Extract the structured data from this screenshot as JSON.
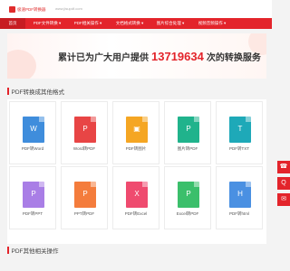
{
  "header": {
    "logo_text": "极速PDF转换器",
    "site_url": "www.jisupdf.com"
  },
  "nav": {
    "items": [
      {
        "label": "首页",
        "active": true
      },
      {
        "label": "PDF文件转换 ▾",
        "active": false
      },
      {
        "label": "PDF相关操作 ▾",
        "active": false
      },
      {
        "label": "文档格式转换 ▾",
        "active": false
      },
      {
        "label": "图片综合处理 ▾",
        "active": false
      },
      {
        "label": "视频音频操作 ▾",
        "active": false
      }
    ]
  },
  "banner": {
    "prefix": "累计已为广大用户提供",
    "count": "13719634",
    "suffix": "次的转换服务"
  },
  "sections": {
    "convert_title": "PDF转换成其他格式",
    "other_title": "PDF其他相关操作"
  },
  "tools_row1": [
    {
      "label": "PDF转Word",
      "color": "#3f8ddc",
      "glyph": "W"
    },
    {
      "label": "Word转PDF",
      "color": "#e84545",
      "glyph": "P"
    },
    {
      "label": "PDF转图片",
      "color": "#f5a623",
      "glyph": "▣"
    },
    {
      "label": "图片转PDF",
      "color": "#20b38c",
      "glyph": "P"
    },
    {
      "label": "PDF转TXT",
      "color": "#1ea9b8",
      "glyph": "T"
    }
  ],
  "tools_row2": [
    {
      "label": "PDF转PPT",
      "color": "#a97ee6",
      "glyph": "P"
    },
    {
      "label": "PPT转PDF",
      "color": "#f47c3c",
      "glyph": "P"
    },
    {
      "label": "PDF转Excel",
      "color": "#ef4b6f",
      "glyph": "X"
    },
    {
      "label": "Excel转PDF",
      "color": "#3bbf6b",
      "glyph": "P"
    },
    {
      "label": "PDF转html",
      "color": "#4a90e2",
      "glyph": "H"
    }
  ],
  "side_tools": {
    "phone_icon": "☎",
    "qq_icon": "Q",
    "mail_icon": "✉"
  }
}
